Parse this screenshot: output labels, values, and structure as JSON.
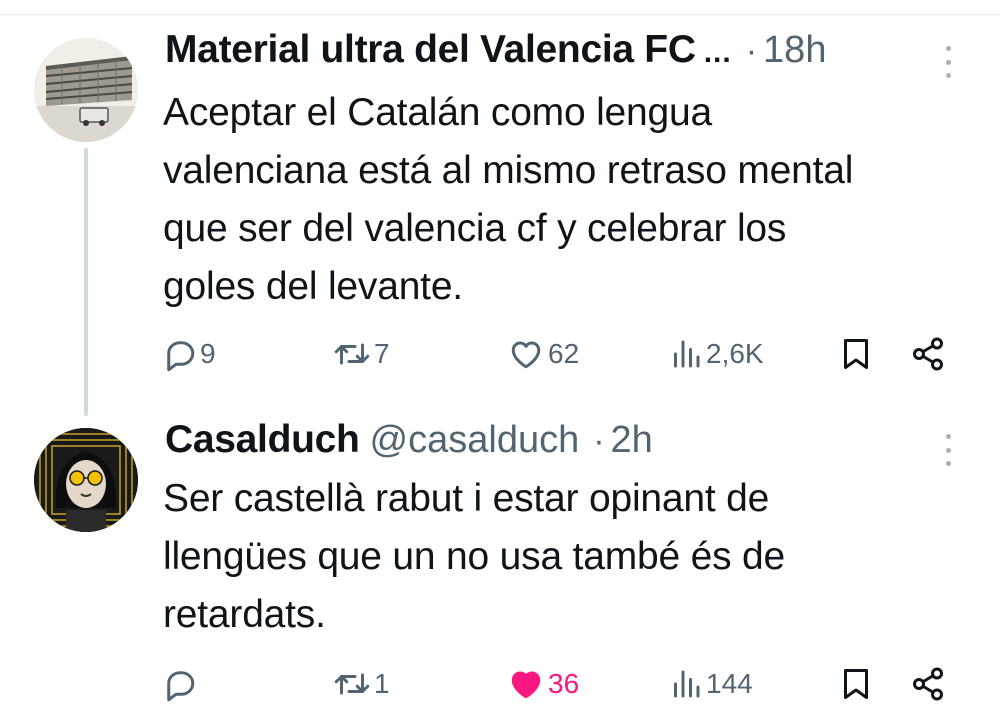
{
  "tweet1": {
    "name": "Material ultra del Valencia FC",
    "truncation": "...",
    "separator": "·",
    "time": "18h",
    "text_lines": [
      "Aceptar el Catalán como lengua",
      "valenciana está al mismo retraso mental",
      "que ser del valencia cf y celebrar los",
      "goles del levante."
    ],
    "replies": "9",
    "retweets": "7",
    "likes": "62",
    "views": "2,6K"
  },
  "tweet2": {
    "name": "Casalduch",
    "handle": "@casalduch",
    "separator": "·",
    "time": "2h",
    "text_lines": [
      "Ser castellà rabut i estar opinant de",
      "llengües que un no usa també és de",
      "retardats."
    ],
    "replies": "",
    "retweets": "1",
    "likes": "36",
    "liked": true,
    "views": "144"
  },
  "icons": {
    "reply": "reply-icon",
    "retweet": "retweet-icon",
    "like": "heart-icon",
    "views": "views-icon",
    "bookmark": "bookmark-icon",
    "share": "share-icon",
    "more": "more-icon"
  },
  "colors": {
    "text": "#0f1419",
    "secondary": "#536471",
    "like_active": "#f91880",
    "thread_line": "#cfd9de"
  }
}
